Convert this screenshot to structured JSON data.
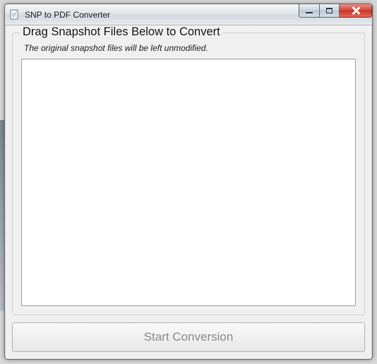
{
  "window": {
    "title": "SNP to PDF Converter"
  },
  "group": {
    "heading": "Drag Snapshot Files Below to Convert",
    "subtext": "The original snapshot files will be left unmodified."
  },
  "actions": {
    "start_label": "Start Conversion"
  }
}
